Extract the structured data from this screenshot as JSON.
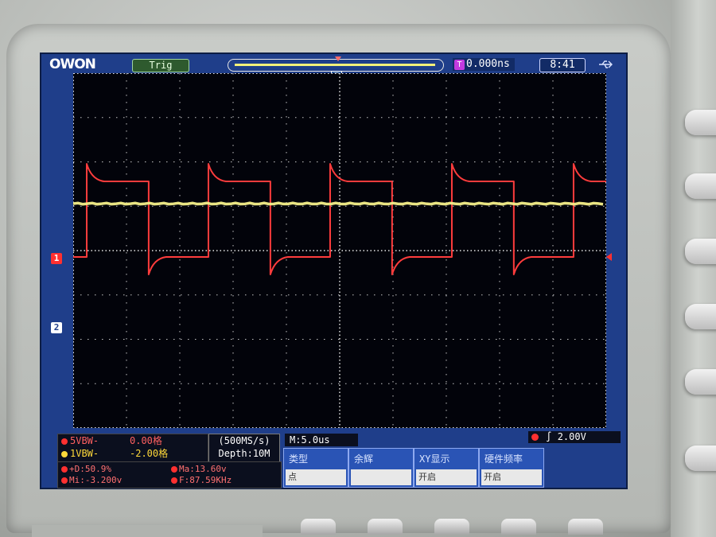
{
  "topbar": {
    "logo": "OWON",
    "trigger_status": "Trig",
    "horizontal_position": "0.000ns",
    "time_position_icon": "T",
    "clock": "8:41",
    "usb_icon": "usb-icon"
  },
  "markers": {
    "ch1": "1",
    "ch2": "2",
    "trigger_position": "T"
  },
  "channels": [
    {
      "name": "CH1",
      "label": "5VBW-",
      "value": "0.00格",
      "color": "#ff3030"
    },
    {
      "name": "CH2",
      "label": "1VBW-",
      "value": "-2.00格",
      "color": "#ffd93a"
    }
  ],
  "acquisition": {
    "sample_rate": "(500MS/s)",
    "depth": "Depth:10M",
    "timebase": "M:5.0us"
  },
  "trigger": {
    "level": "2.00V"
  },
  "measurements": [
    {
      "text": "+D:50.9%"
    },
    {
      "text": "Ma:13.60v"
    },
    {
      "text": "Mi:-3.200v"
    },
    {
      "text": "F:87.59KHz"
    }
  ],
  "softkeys": [
    {
      "top": "类型",
      "bottom": "点"
    },
    {
      "top": "余辉",
      "bottom": ""
    },
    {
      "top": "XY显示",
      "bottom": "开启"
    },
    {
      "top": "硬件频率",
      "bottom": "开启"
    }
  ],
  "colors": {
    "ch1_trace": "#ff3c3c",
    "ch2_trace": "#f5f08a",
    "screen_frame": "#1f3e8a",
    "grid": "#e8e8e8"
  },
  "waveform": {
    "ch1": {
      "type": "square",
      "duty_percent": 50.9,
      "max_v": 13.6,
      "min_v": -3.2,
      "frequency_khz": 87.59
    },
    "ch2": {
      "type": "flat"
    }
  }
}
